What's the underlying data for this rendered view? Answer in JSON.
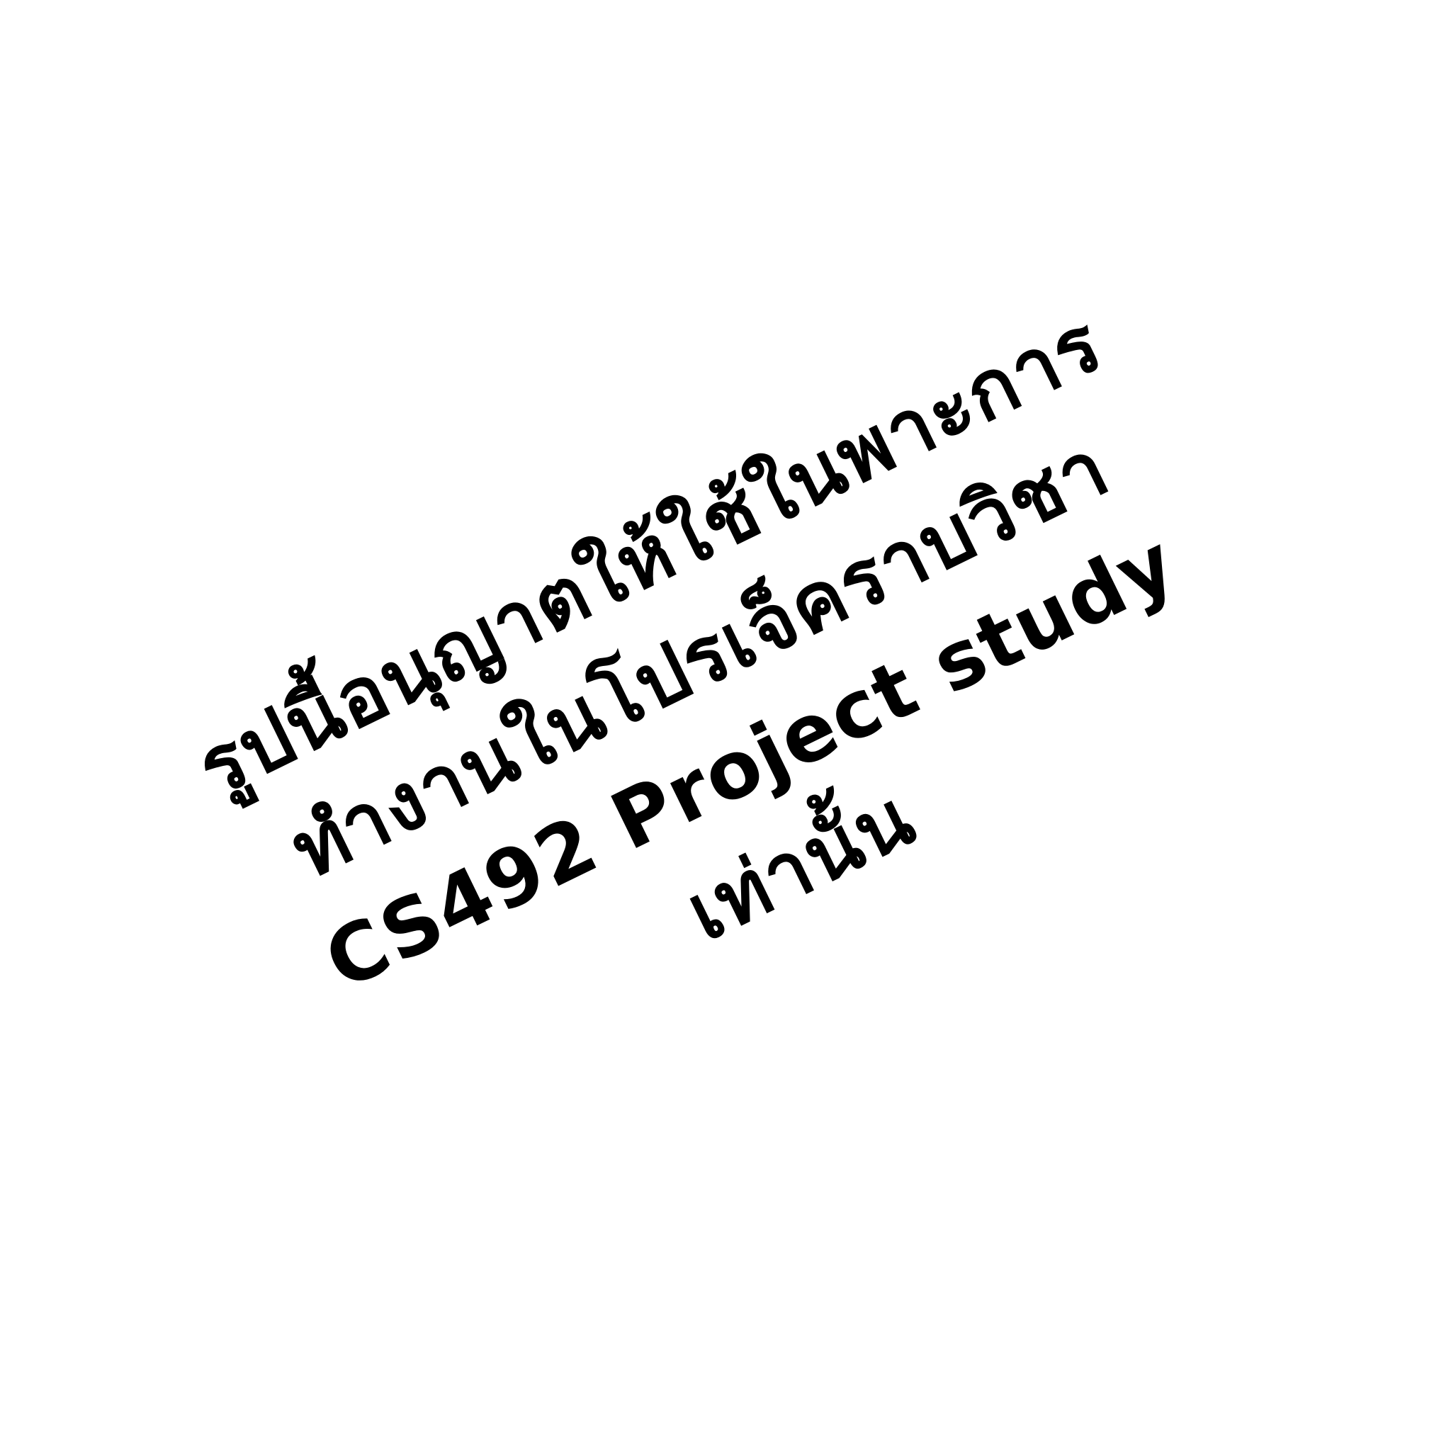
{
  "notice": {
    "lines": [
      "รูปนี้อนุญาตให้ใช้ในพาะการ",
      "ทำงานในโปรเจ็คราบวิชา",
      "CS492 Project study",
      "เท่านั้น"
    ]
  },
  "colors": {
    "background": "#ffffff",
    "text": "#000000"
  }
}
